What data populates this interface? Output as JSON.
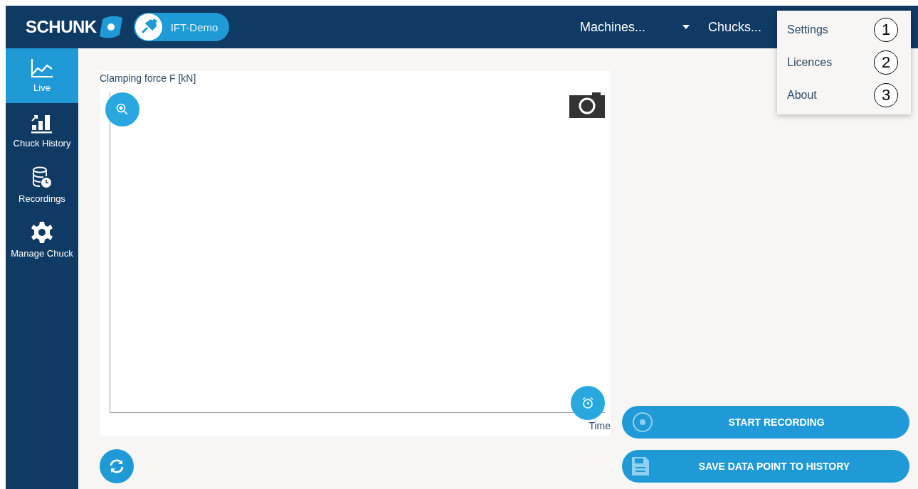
{
  "header": {
    "logo": "SCHUNK",
    "badge": "IFT-Demo",
    "machines": "Machines...",
    "chucks": "Chucks..."
  },
  "menu": [
    {
      "label": "Settings",
      "callout": "1"
    },
    {
      "label": "Licences",
      "callout": "2"
    },
    {
      "label": "About",
      "callout": "3"
    }
  ],
  "sidebar": [
    {
      "label": "Live",
      "kind": "chart",
      "selected": true
    },
    {
      "label": "Chuck History",
      "kind": "bars",
      "selected": false
    },
    {
      "label": "Recordings",
      "kind": "db",
      "selected": false
    },
    {
      "label": "Manage Chuck",
      "kind": "gear",
      "selected": false
    }
  ],
  "chart": {
    "ylabel": "Clamping force F [kN]",
    "xlabel": "Time"
  },
  "actions": [
    {
      "label": "START RECORDING",
      "kind": "record"
    },
    {
      "label": "SAVE DATA POINT TO HISTORY",
      "kind": "save"
    }
  ]
}
